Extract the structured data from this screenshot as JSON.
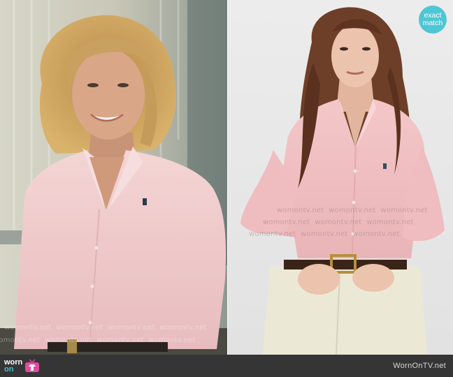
{
  "badge": {
    "line1": "exact",
    "line2": "match"
  },
  "watermark": {
    "text": "womontv.net"
  },
  "footer": {
    "logo_top": "worn",
    "logo_bottom": "on",
    "logo_tv_icon": "tv-icon",
    "site_name": "WornOnTV.net"
  },
  "colors": {
    "badge": "#4fc6d4",
    "footer_bg": "#353535",
    "logo_accent": "#48bfd0",
    "shirt_pink": "#f2c4c6"
  }
}
